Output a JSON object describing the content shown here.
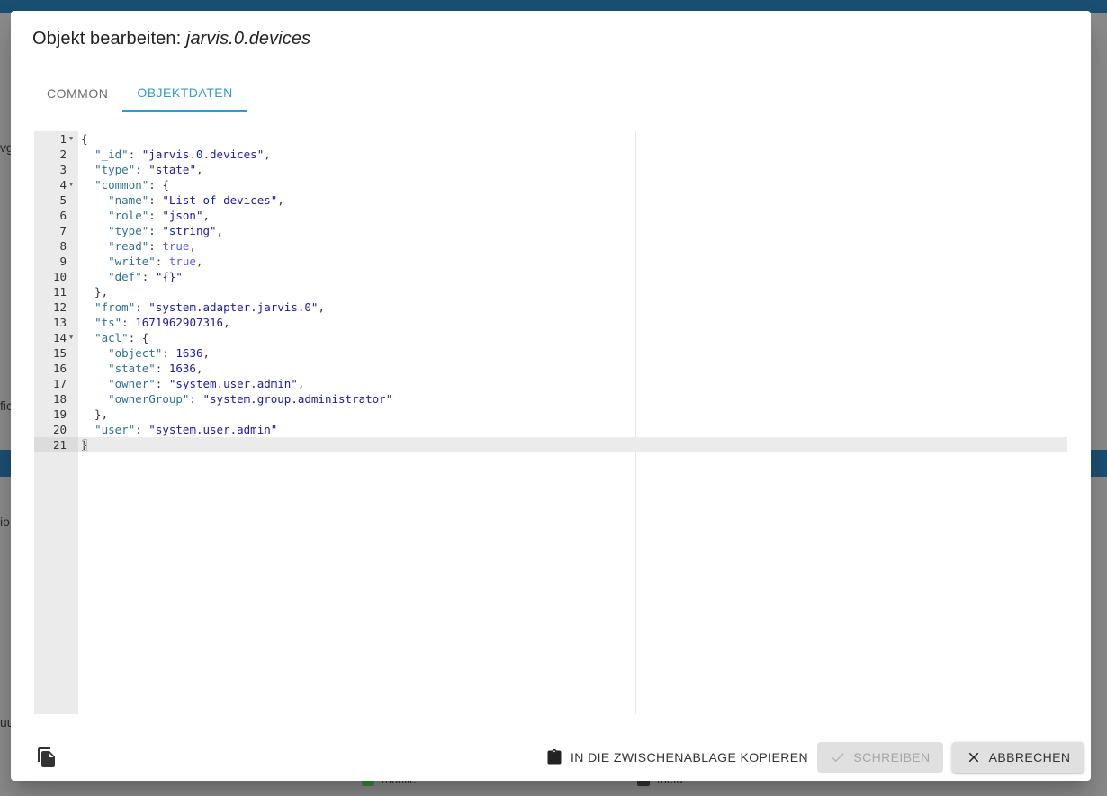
{
  "background": {
    "fragments": [
      "vg",
      "fic",
      "io",
      "uu"
    ],
    "bottom_items": [
      "mobile",
      "meta"
    ]
  },
  "dialog": {
    "title_prefix": "Objekt bearbeiten: ",
    "object_id": "jarvis.0.devices",
    "tabs": [
      {
        "label": "COMMON",
        "active": false
      },
      {
        "label": "OBJEKTDATEN",
        "active": true
      }
    ],
    "editor": {
      "active_line": 21,
      "line_numbers": [
        "1",
        "2",
        "3",
        "4",
        "5",
        "6",
        "7",
        "8",
        "9",
        "10",
        "11",
        "12",
        "13",
        "14",
        "15",
        "16",
        "17",
        "18",
        "19",
        "20",
        "21"
      ]
    },
    "footer": {
      "copy_label": "IN DIE ZWISCHENABLAGE KOPIEREN",
      "write_label": "SCHREIBEN",
      "cancel_label": "ABBRECHEN"
    },
    "json": {
      "_id": "jarvis.0.devices",
      "type": "state",
      "common": {
        "name": "List of devices",
        "role": "json",
        "type": "string",
        "read": "true",
        "write": "true",
        "def": "{}"
      },
      "from": "system.adapter.jarvis.0",
      "ts": "1671962907316",
      "acl": {
        "object": "1636",
        "state": "1636",
        "owner": "system.user.admin",
        "ownerGroup": "system.group.administrator"
      },
      "user": "system.user.admin"
    }
  },
  "colors": {
    "accent": "#3399cc",
    "key": "#31708f",
    "string": "#1a1aa6",
    "boolean": "#585cf6"
  }
}
